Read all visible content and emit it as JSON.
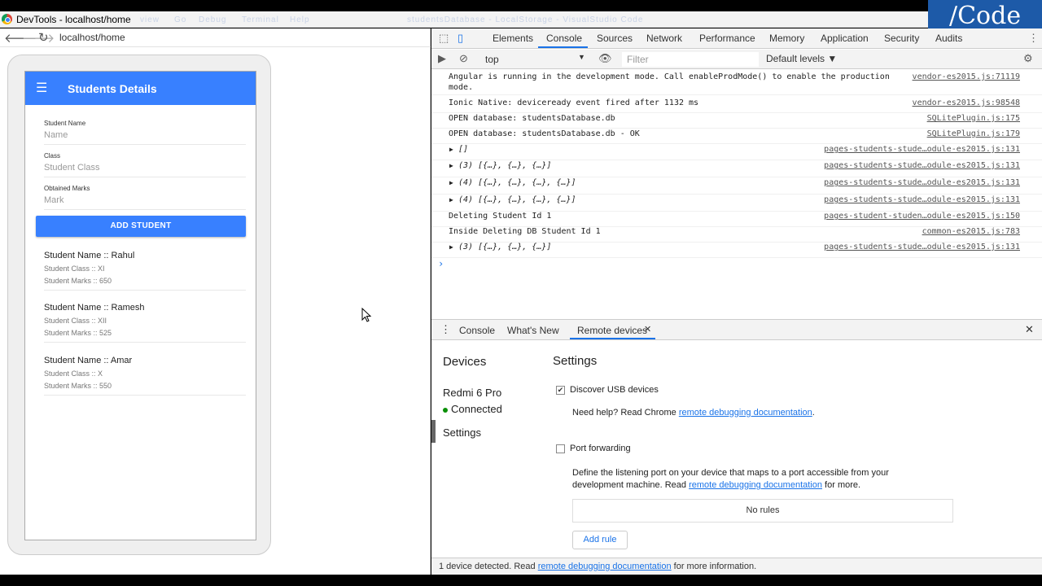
{
  "window": {
    "title": "DevTools - localhost/home",
    "ghost_tabs": [
      "view",
      "Go",
      "Debug",
      "Terminal",
      "Help"
    ],
    "ghost_path": "studentsDatabase - LocalStorage - VisualStudio Code"
  },
  "brand": {
    "text": "/Code",
    "color": "#1d5aa8"
  },
  "browser": {
    "back_icon": "back-arrow-icon",
    "forward_icon": "forward-arrow-icon",
    "reload_icon": "reload-icon",
    "url": "localhost/home"
  },
  "app": {
    "toolbar_title": "Students Details",
    "accent_color": "#3880ff",
    "form": {
      "name_label": "Student Name",
      "name_placeholder": "Name",
      "class_label": "Class",
      "class_placeholder": "Student Class",
      "marks_label": "Obtained Marks",
      "marks_placeholder": "Mark",
      "add_button": "ADD STUDENT"
    },
    "students": [
      {
        "name": "Student Name :: Rahul",
        "class": "Student Class :: XI",
        "marks": "Student Marks :: 650"
      },
      {
        "name": "Student Name :: Ramesh",
        "class": "Student Class :: XII",
        "marks": "Student Marks :: 525"
      },
      {
        "name": "Student Name :: Amar",
        "class": "Student Class :: X",
        "marks": "Student Marks :: 550"
      }
    ]
  },
  "devtools": {
    "tabs": [
      "Elements",
      "Console",
      "Sources",
      "Network",
      "Performance",
      "Memory",
      "Application",
      "Security",
      "Audits"
    ],
    "active_tab": "Console",
    "console_bar": {
      "context": "top",
      "filter_placeholder": "Filter",
      "levels": "Default levels ▼"
    },
    "logs": [
      {
        "msg": "Angular is running in the development mode. Call enableProdMode() to enable the production",
        "msg2": "mode.",
        "src": "vendor-es2015.js:71119"
      },
      {
        "msg": "Ionic Native: deviceready event fired after 1132 ms",
        "src": "vendor-es2015.js:98548"
      },
      {
        "msg": "OPEN database: studentsDatabase.db",
        "src": "SQLitePlugin.js:175"
      },
      {
        "msg": "OPEN database: studentsDatabase.db - OK",
        "src": "SQLitePlugin.js:179"
      },
      {
        "obj": "[]",
        "src": "pages-students-stude…odule-es2015.js:131"
      },
      {
        "obj": "(3) [{…}, {…}, {…}]",
        "src": "pages-students-stude…odule-es2015.js:131"
      },
      {
        "obj": "(4) [{…}, {…}, {…}, {…}]",
        "src": "pages-students-stude…odule-es2015.js:131"
      },
      {
        "obj": "(4) [{…}, {…}, {…}, {…}]",
        "src": "pages-students-stude…odule-es2015.js:131"
      },
      {
        "msg": "Deleting Student Id 1",
        "src": "pages-student-studen…odule-es2015.js:150"
      },
      {
        "msg": "Inside Deleting DB Student Id 1",
        "src": "common-es2015.js:783"
      },
      {
        "obj": "(3) [{…}, {…}, {…}]",
        "src": "pages-students-stude…odule-es2015.js:131"
      }
    ],
    "prompt": "›",
    "drawer": {
      "tabs": [
        "Console",
        "What's New",
        "Remote devices"
      ],
      "active_tab": "Remote devices",
      "devices_heading": "Devices",
      "device_name": "Redmi 6 Pro",
      "device_status": "Connected",
      "settings_item": "Settings",
      "settings_heading": "Settings",
      "discover_usb": "Discover USB devices",
      "discover_checked": true,
      "help_prefix": "Need help? Read Chrome ",
      "help_link": "remote debugging documentation",
      "help_suffix": ".",
      "port_forwarding": "Port forwarding",
      "port_checked": false,
      "pf_desc1": "Define the listening port on your device that maps to a port accessible from your",
      "pf_desc2_prefix": "development machine. Read ",
      "pf_desc2_link": "remote debugging documentation",
      "pf_desc2_suffix": " for more.",
      "no_rules": "No rules",
      "add_rule": "Add rule",
      "status_prefix": "1 device detected. Read ",
      "status_link": "remote debugging documentation",
      "status_suffix": " for more information."
    }
  }
}
